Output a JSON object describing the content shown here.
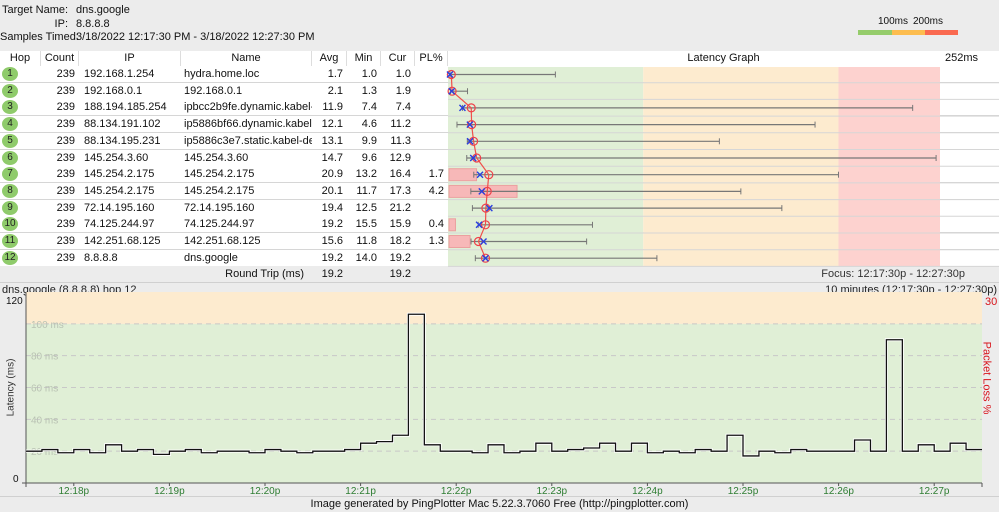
{
  "header": {
    "target_name_label": "Target Name:",
    "target_name": "dns.google",
    "ip_label": "IP:",
    "ip": "8.8.8.8",
    "samples_label": "Samples Timed:",
    "samples": "3/18/2022 12:17:30 PM - 3/18/2022 12:27:30 PM"
  },
  "legend": {
    "label_100": "100ms",
    "label_200": "200ms",
    "colors": [
      "#95cc6b",
      "#fdbd4f",
      "#fa6a50"
    ]
  },
  "columns": {
    "hop": "Hop",
    "count": "Count",
    "ip": "IP",
    "name": "Name",
    "avg": "Avg",
    "min": "Min",
    "cur": "Cur",
    "pl": "PL%",
    "graph": "Latency Graph",
    "graph_max": "252ms"
  },
  "graph_scale_ms": 252,
  "zone_colors": {
    "good": "#e0efd6",
    "warn": "#fdebcf",
    "bad": "#fdd2cf"
  },
  "hops": [
    {
      "hop": "1",
      "count": "239",
      "ip": "192.168.1.254",
      "name": "hydra.home.loc",
      "avg": "1.7",
      "min": "1.0",
      "cur": "1.0",
      "pl": "",
      "max": 55
    },
    {
      "hop": "2",
      "count": "239",
      "ip": "192.168.0.1",
      "name": "192.168.0.1",
      "avg": "2.1",
      "min": "1.3",
      "cur": "1.9",
      "pl": "",
      "max": 10
    },
    {
      "hop": "3",
      "count": "239",
      "ip": "188.194.185.254",
      "name": "ipbcc2b9fe.dynamic.kabel-deu",
      "avg": "11.9",
      "min": "7.4",
      "cur": "7.4",
      "pl": "",
      "max": 238
    },
    {
      "hop": "4",
      "count": "239",
      "ip": "88.134.191.102",
      "name": "ip5886bf66.dynamic.kabel-de",
      "avg": "12.1",
      "min": "4.6",
      "cur": "11.2",
      "pl": "",
      "max": 188
    },
    {
      "hop": "5",
      "count": "239",
      "ip": "88.134.195.231",
      "name": "ip5886c3e7.static.kabel-deuts",
      "avg": "13.1",
      "min": "9.9",
      "cur": "11.3",
      "pl": "",
      "max": 139
    },
    {
      "hop": "6",
      "count": "239",
      "ip": "145.254.3.60",
      "name": "145.254.3.60",
      "avg": "14.7",
      "min": "9.6",
      "cur": "12.9",
      "pl": "",
      "max": 250
    },
    {
      "hop": "7",
      "count": "239",
      "ip": "145.254.2.175",
      "name": "145.254.2.175",
      "avg": "20.9",
      "min": "13.2",
      "cur": "16.4",
      "pl": "1.7",
      "max": 200
    },
    {
      "hop": "8",
      "count": "239",
      "ip": "145.254.2.175",
      "name": "145.254.2.175",
      "avg": "20.1",
      "min": "11.7",
      "cur": "17.3",
      "pl": "4.2",
      "max": 150
    },
    {
      "hop": "9",
      "count": "239",
      "ip": "72.14.195.160",
      "name": "72.14.195.160",
      "avg": "19.4",
      "min": "12.5",
      "cur": "21.2",
      "pl": "",
      "max": 171
    },
    {
      "hop": "10",
      "count": "239",
      "ip": "74.125.244.97",
      "name": "74.125.244.97",
      "avg": "19.2",
      "min": "15.5",
      "cur": "15.9",
      "pl": "0.4",
      "max": 74
    },
    {
      "hop": "11",
      "count": "239",
      "ip": "142.251.68.125",
      "name": "142.251.68.125",
      "avg": "15.6",
      "min": "11.8",
      "cur": "18.2",
      "pl": "1.3",
      "max": 71
    },
    {
      "hop": "12",
      "count": "239",
      "ip": "8.8.8.8",
      "name": "dns.google",
      "avg": "19.2",
      "min": "14.0",
      "cur": "19.2",
      "pl": "",
      "max": 107
    }
  ],
  "round_trip": {
    "label": "Round Trip (ms)",
    "avg": "19.2",
    "cur": "19.2",
    "focus": "Focus: 12:17:30p - 12:27:30p"
  },
  "chart_data": {
    "type": "line",
    "title": "dns.google (8.8.8.8) hop 12",
    "range_label": "10 minutes (12:17:30p - 12:27:30p)",
    "ylabel": "Latency (ms)",
    "y2label": "Packet Loss %",
    "y2max": "30",
    "ylim": [
      0,
      120
    ],
    "xlim": [
      "12:17:30",
      "12:27:30"
    ],
    "y_ticks": [
      {
        "v": 0,
        "label": "0"
      },
      {
        "v": 120,
        "label": "120"
      }
    ],
    "y_grid_labels": [
      {
        "v": 20,
        "label": "20 ms"
      },
      {
        "v": 40,
        "label": "40 ms"
      },
      {
        "v": 60,
        "label": "60 ms"
      },
      {
        "v": 80,
        "label": "80 ms"
      },
      {
        "v": 100,
        "label": "100 ms"
      }
    ],
    "x_ticks": [
      {
        "t": "12:18:00",
        "label": "12:18p"
      },
      {
        "t": "12:19:00",
        "label": "12:19p"
      },
      {
        "t": "12:20:00",
        "label": "12:20p"
      },
      {
        "t": "12:21:00",
        "label": "12:21p"
      },
      {
        "t": "12:22:00",
        "label": "12:22p"
      },
      {
        "t": "12:23:00",
        "label": "12:23p"
      },
      {
        "t": "12:24:00",
        "label": "12:24p"
      },
      {
        "t": "12:25:00",
        "label": "12:25p"
      },
      {
        "t": "12:26:00",
        "label": "12:26p"
      },
      {
        "t": "12:27:00",
        "label": "12:27p"
      }
    ],
    "zones": [
      {
        "from": 0,
        "to": 100,
        "color": "#e0efd6"
      },
      {
        "from": 100,
        "to": 120,
        "color": "#fdebcf"
      }
    ],
    "points": [
      [
        "12:17:30",
        20
      ],
      [
        "12:17:40",
        21
      ],
      [
        "12:17:50",
        19
      ],
      [
        "12:18:00",
        21
      ],
      [
        "12:18:10",
        19
      ],
      [
        "12:18:20",
        24
      ],
      [
        "12:18:30",
        20
      ],
      [
        "12:18:40",
        21
      ],
      [
        "12:18:50",
        18
      ],
      [
        "12:19:00",
        20
      ],
      [
        "12:19:10",
        21
      ],
      [
        "12:19:20",
        19
      ],
      [
        "12:19:30",
        20
      ],
      [
        "12:19:40",
        20
      ],
      [
        "12:19:50",
        19
      ],
      [
        "12:20:00",
        21
      ],
      [
        "12:20:10",
        20
      ],
      [
        "12:20:20",
        19
      ],
      [
        "12:20:30",
        20
      ],
      [
        "12:20:40",
        20
      ],
      [
        "12:20:50",
        21
      ],
      [
        "12:21:00",
        25
      ],
      [
        "12:21:10",
        26
      ],
      [
        "12:21:20",
        30
      ],
      [
        "12:21:30",
        106
      ],
      [
        "12:21:40",
        24
      ],
      [
        "12:21:50",
        20
      ],
      [
        "12:22:00",
        20
      ],
      [
        "12:22:10",
        19
      ],
      [
        "12:22:20",
        24
      ],
      [
        "12:22:30",
        19
      ],
      [
        "12:22:40",
        20
      ],
      [
        "12:22:50",
        25
      ],
      [
        "12:23:00",
        20
      ],
      [
        "12:23:10",
        21
      ],
      [
        "12:23:20",
        22
      ],
      [
        "12:23:30",
        25
      ],
      [
        "12:23:40",
        20
      ],
      [
        "12:23:50",
        25
      ],
      [
        "12:24:00",
        19
      ],
      [
        "12:24:10",
        20
      ],
      [
        "12:24:20",
        19
      ],
      [
        "12:24:30",
        21
      ],
      [
        "12:24:40",
        20
      ],
      [
        "12:24:50",
        30
      ],
      [
        "12:25:00",
        17
      ],
      [
        "12:25:10",
        20
      ],
      [
        "12:25:20",
        19
      ],
      [
        "12:25:30",
        21
      ],
      [
        "12:25:40",
        20
      ],
      [
        "12:25:50",
        20
      ],
      [
        "12:26:00",
        20
      ],
      [
        "12:26:10",
        27
      ],
      [
        "12:26:20",
        20
      ],
      [
        "12:26:30",
        90
      ],
      [
        "12:26:40",
        20
      ],
      [
        "12:26:50",
        24
      ],
      [
        "12:27:00",
        20
      ],
      [
        "12:27:10",
        25
      ],
      [
        "12:27:20",
        21
      ]
    ]
  },
  "footer": "Image generated by PingPlotter Mac 5.22.3.7060 Free (http://pingplotter.com)"
}
